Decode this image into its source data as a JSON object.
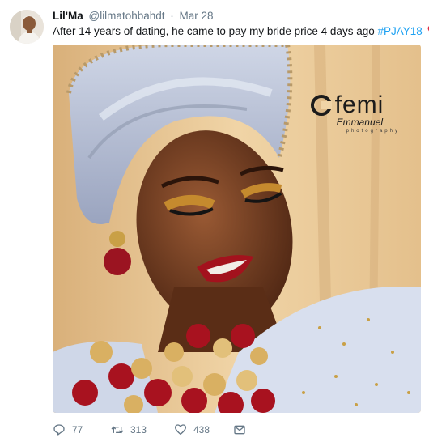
{
  "tweet": {
    "display_name": "Lil'Ma",
    "handle": "@lilmatohbahdt",
    "separator": "·",
    "date": "Mar 28",
    "text": "After 14 years of dating, he came to pay my bride price 4 days ago ",
    "hashtag": "#PJAY18",
    "emoji": "red-heart-icon"
  },
  "media": {
    "watermark": {
      "name": "femi",
      "subname": "Emmanuel",
      "tagline": "photography"
    }
  },
  "actions": {
    "reply_count": "77",
    "retweet_count": "313",
    "like_count": "438"
  },
  "colors": {
    "link": "#1da1f2",
    "muted": "#657786",
    "heart": "#e0245e"
  }
}
